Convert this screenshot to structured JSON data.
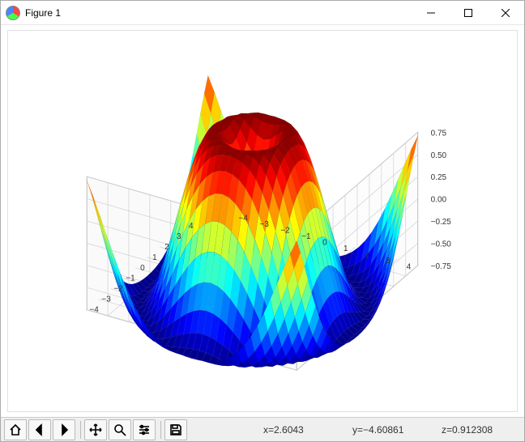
{
  "window": {
    "title": "Figure 1"
  },
  "chart_data": {
    "type": "surface3d",
    "function_hint": "z = sin( sqrt(x^2 + y^2) )",
    "x_range": [
      -5,
      5
    ],
    "y_range": [
      -5,
      5
    ],
    "z_range": [
      -0.75,
      0.75
    ],
    "x_ticks": [
      -4,
      -3,
      -2,
      -1,
      0,
      1,
      2,
      3,
      4
    ],
    "y_ticks": [
      -4,
      -3,
      -2,
      -1,
      0,
      1,
      2,
      3,
      4
    ],
    "z_ticks": [
      -0.75,
      -0.5,
      -0.25,
      0.0,
      0.25,
      0.5,
      0.75
    ],
    "colormap": "jet",
    "grid": true,
    "title": "",
    "xlabel": "",
    "ylabel": "",
    "zlabel": ""
  },
  "axis_labels": {
    "x": {
      "m4": "−4",
      "m3": "−3",
      "m2": "−2",
      "m1": "−1",
      "z0": "0",
      "p1": "1",
      "p2": "2",
      "p3": "3",
      "p4": "4"
    },
    "y": {
      "m4": "−4",
      "m3": "−3",
      "m2": "−2",
      "m1": "−1",
      "z0": "0",
      "p1": "1",
      "p2": "2",
      "p3": "3",
      "p4": "4"
    },
    "z": {
      "m075": "−0.75",
      "m050": "−0.50",
      "m025": "−0.25",
      "z000": "0.00",
      "p025": "0.25",
      "p050": "0.50",
      "p075": "0.75"
    }
  },
  "status": {
    "x": "x=2.6043",
    "y": "y=−4.60861",
    "z": "z=0.912308"
  }
}
